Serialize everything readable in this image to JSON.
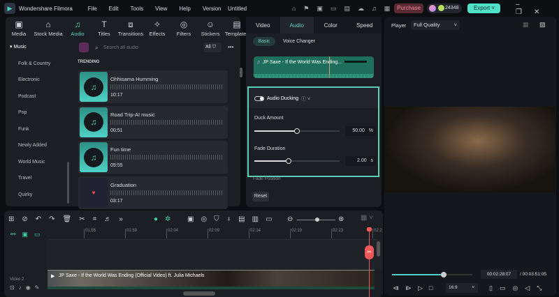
{
  "app": {
    "name": "Wondershare Filmora",
    "project": "Untitled",
    "menu": [
      "File",
      "Edit",
      "Tools",
      "View",
      "Help",
      "Version"
    ],
    "purchase": "Purchase",
    "credits": "24348",
    "export": "Export"
  },
  "toolbar": [
    {
      "label": "Media",
      "icon": "media-icon"
    },
    {
      "label": "Stock Media",
      "icon": "stock-icon"
    },
    {
      "label": "Audio",
      "icon": "music-icon"
    },
    {
      "label": "Titles",
      "icon": "titles-icon"
    },
    {
      "label": "Transitions",
      "icon": "transitions-icon"
    },
    {
      "label": "Effects",
      "icon": "effects-icon"
    },
    {
      "label": "Filters",
      "icon": "filters-icon"
    },
    {
      "label": "Stickers",
      "icon": "stickers-icon"
    },
    {
      "label": "Templates",
      "icon": "templates-icon"
    }
  ],
  "sidebar": {
    "header": "Music",
    "items": [
      "Folk & Country",
      "Electronic",
      "Podcast",
      "Pop",
      "Funk",
      "Newly Added",
      "World Music",
      "Travel",
      "Quirky"
    ]
  },
  "audio": {
    "search_placeholder": "Search all audio",
    "filter": "All",
    "section": "TRENDING",
    "tracks": [
      {
        "title": "Ohhisama Humming",
        "duration": "10:17"
      },
      {
        "title": "Road Trip-AI music",
        "duration": "00:51"
      },
      {
        "title": "Fun time",
        "duration": "05:55"
      },
      {
        "title": "Graduation",
        "duration": "03:17"
      }
    ]
  },
  "props": {
    "tabs": [
      "Video",
      "Audio",
      "Color",
      "Speed"
    ],
    "subtabs": [
      "Basic",
      "Voice Changer"
    ],
    "clip_title": "JP Saxe - If the World Was Ending...",
    "ducking": "Audio Ducking",
    "duck_label": "Duck Amount",
    "duck_value": "50.00",
    "duck_unit": "%",
    "duck_pct": 50,
    "fade_label": "Fade Duration",
    "fade_value": "2.00",
    "fade_unit": "s",
    "fade_pct": 40,
    "fade_position": "Fade Position",
    "reset": "Reset"
  },
  "player": {
    "label": "Player",
    "quality": "Full Quality",
    "current": "00:02:28:07",
    "total": "/ 00:03:51:05",
    "progress_pct": 64,
    "ratio": "16:9"
  },
  "timeline": {
    "ticks": [
      "01:55",
      "01:59",
      "02:04",
      "02:09",
      "02:14",
      "02:19",
      "02:23",
      "02:2"
    ],
    "track": "Video 2",
    "clip": "JP Saxe - If the World Was Ending (Official Video) ft. Julia Michaels"
  },
  "colors": {
    "accent": "#4fd1c5",
    "playhead": "#f0585a"
  }
}
